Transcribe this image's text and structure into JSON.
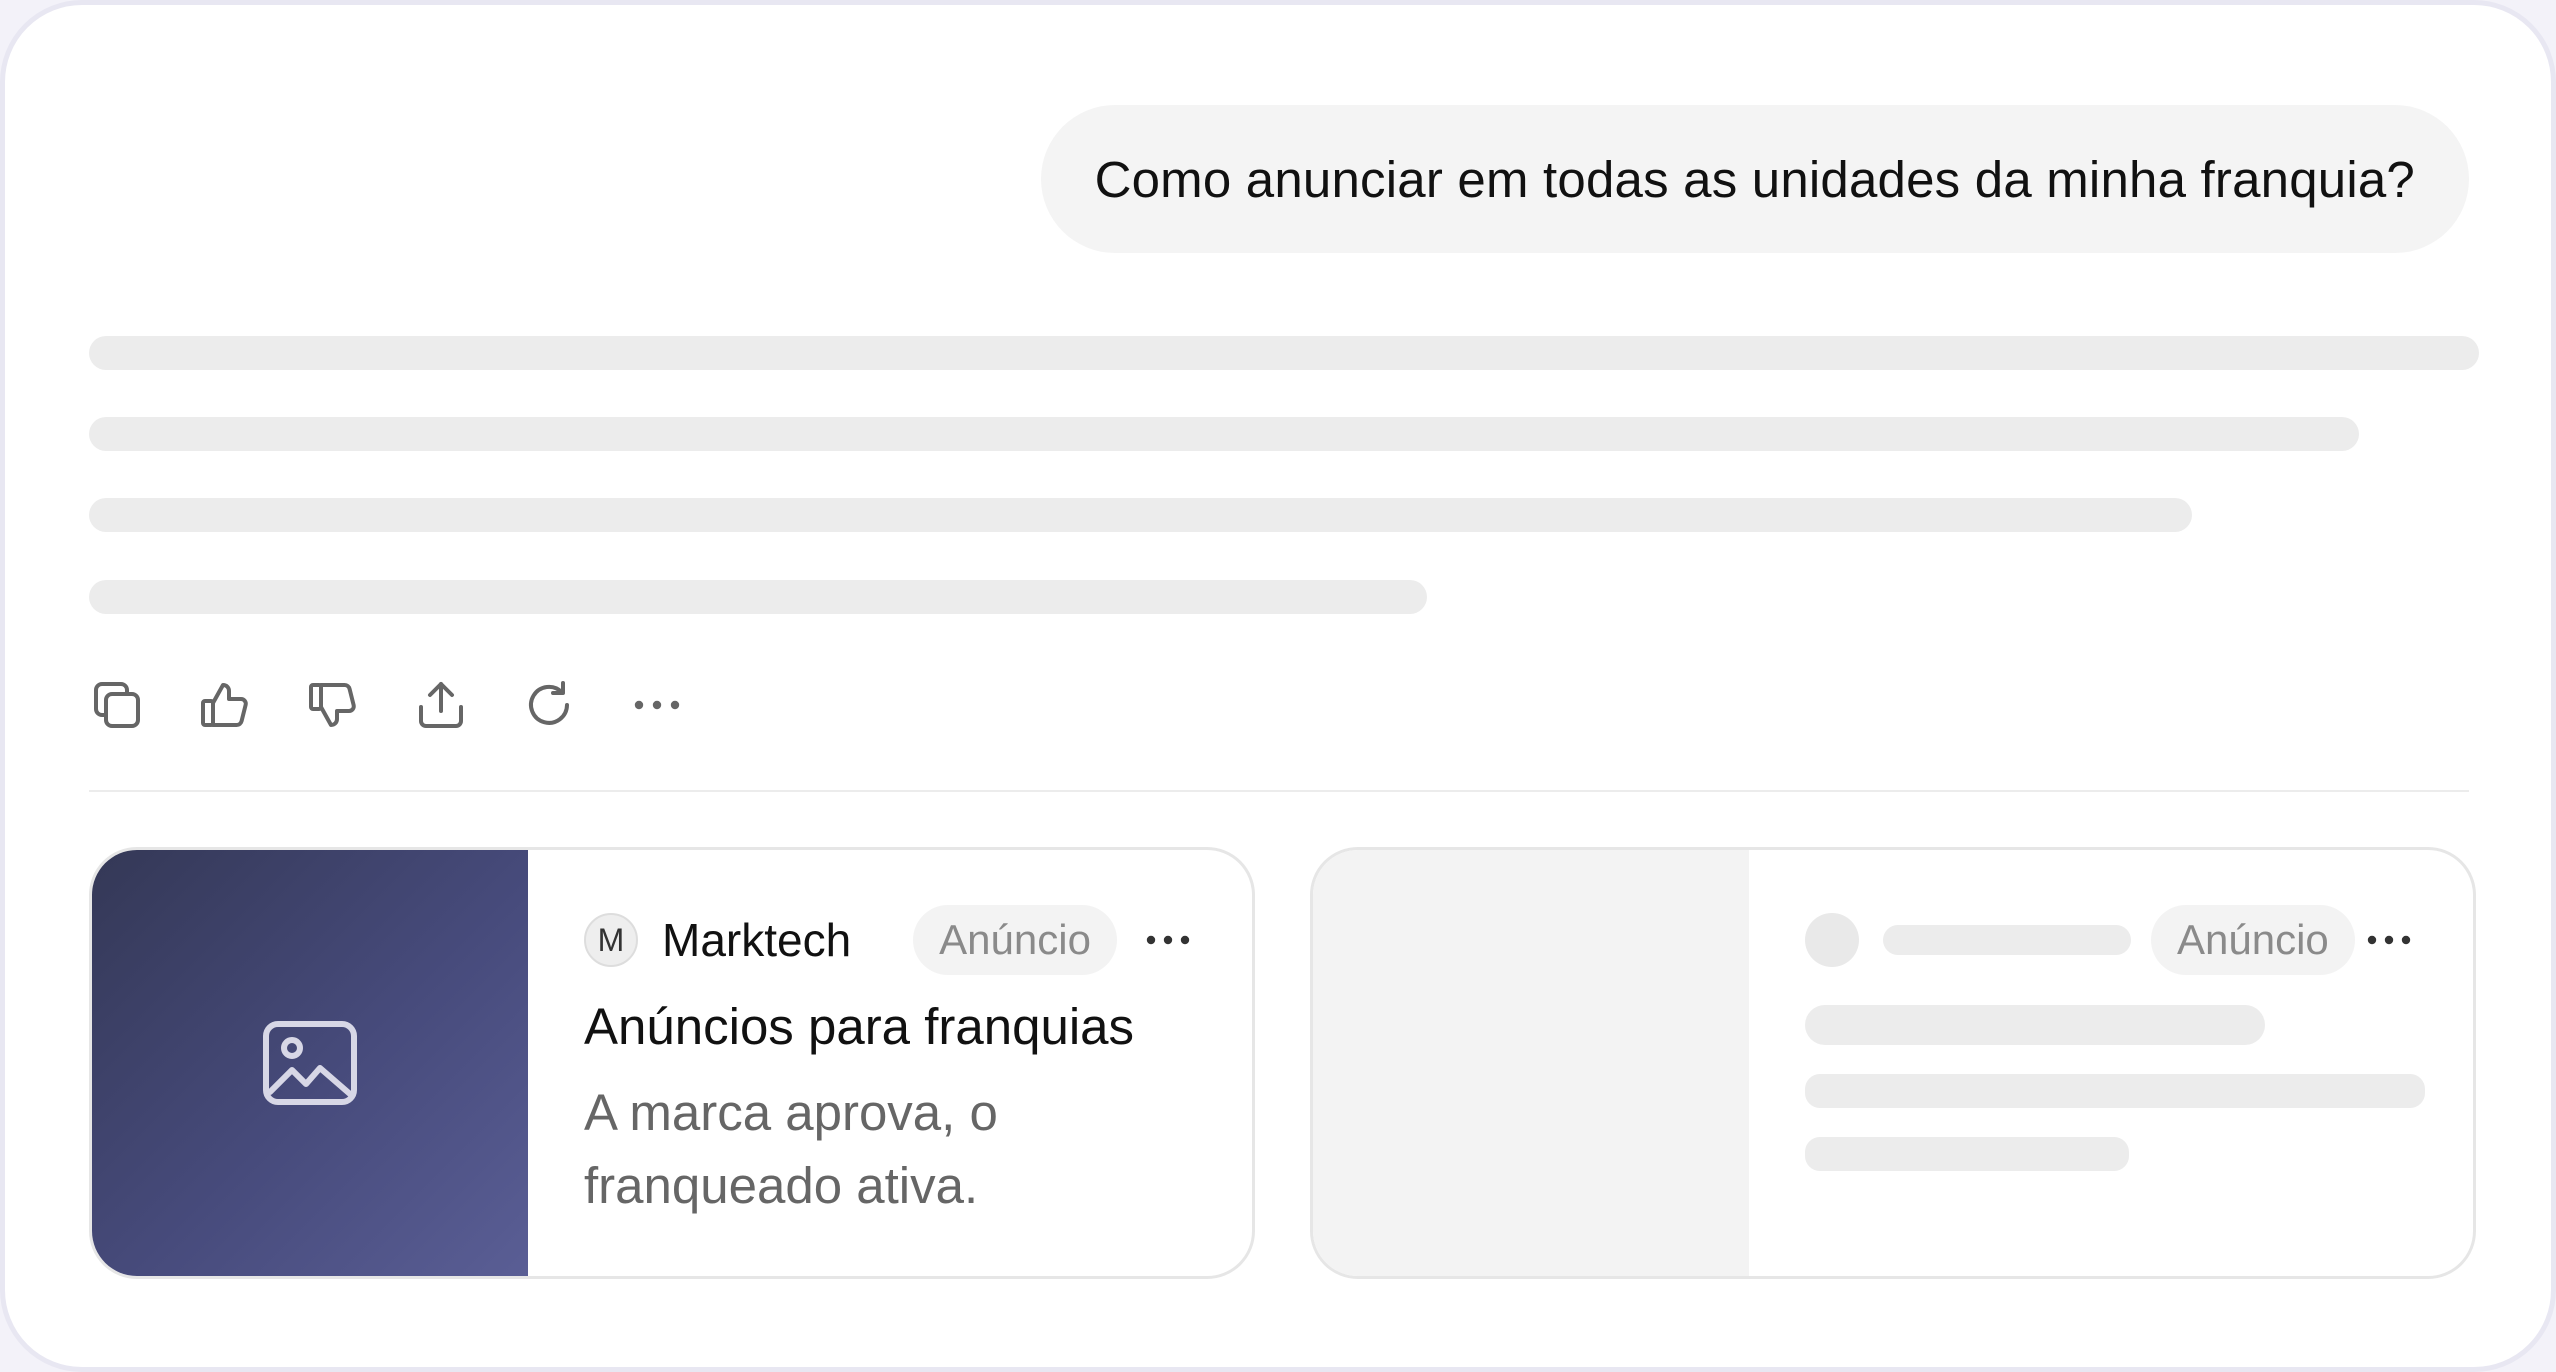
{
  "chat": {
    "user_message": "Como anunciar em todas as unidades da minha franquia?"
  },
  "response_actions": [
    {
      "name": "copy-icon"
    },
    {
      "name": "thumbs-up-icon"
    },
    {
      "name": "thumbs-down-icon"
    },
    {
      "name": "share-icon"
    },
    {
      "name": "regenerate-icon"
    },
    {
      "name": "more-options-icon"
    }
  ],
  "ads": {
    "card1": {
      "avatar_letter": "M",
      "advertiser": "Marktech",
      "badge": "Anúncio",
      "title": "Anúncios para franquias",
      "description": "A marca aprova, o franqueado ativa.",
      "image_icon": "image-placeholder-icon"
    },
    "card2": {
      "badge": "Anúncio"
    }
  },
  "colors": {
    "media_gradient_start": "#343856",
    "media_gradient_end": "#5a5e95",
    "skeleton": "#ececec",
    "bubble": "#f4f4f4"
  }
}
